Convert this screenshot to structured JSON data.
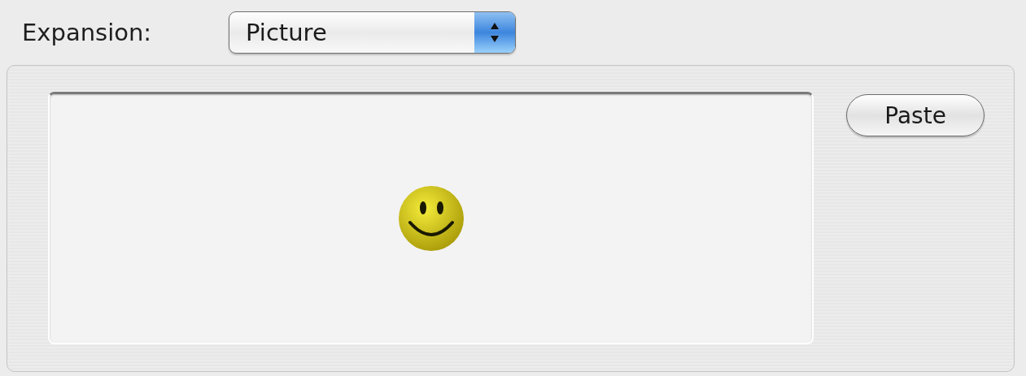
{
  "expansion": {
    "label": "Expansion:",
    "value": "Picture"
  },
  "paste_button": {
    "label": "Paste"
  }
}
